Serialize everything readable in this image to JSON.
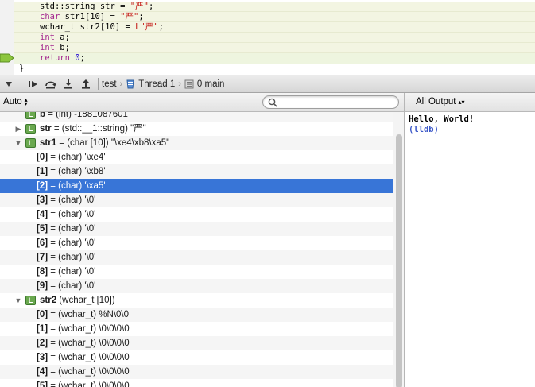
{
  "editor": {
    "lines": [
      {
        "segments": [
          {
            "cls": "plain",
            "text": "std::string str = "
          },
          {
            "cls": "str",
            "text": "\"严\""
          },
          {
            "cls": "plain",
            "text": ";"
          }
        ]
      },
      {
        "segments": [
          {
            "cls": "kw",
            "text": "char"
          },
          {
            "cls": "plain",
            "text": " str1[10] = "
          },
          {
            "cls": "str",
            "text": "\"严\""
          },
          {
            "cls": "plain",
            "text": ";"
          }
        ]
      },
      {
        "segments": [
          {
            "cls": "plain",
            "text": "wchar_t str2[10] = "
          },
          {
            "cls": "str",
            "text": "L\"严\""
          },
          {
            "cls": "plain",
            "text": ";"
          }
        ]
      },
      {
        "segments": [
          {
            "cls": "kw",
            "text": "int"
          },
          {
            "cls": "plain",
            "text": " a;"
          }
        ]
      },
      {
        "segments": [
          {
            "cls": "kw",
            "text": "int"
          },
          {
            "cls": "plain",
            "text": " b;"
          }
        ]
      },
      {
        "segments": [
          {
            "cls": "kw",
            "text": "return"
          },
          {
            "cls": "plain",
            "text": " "
          },
          {
            "cls": "num",
            "text": "0"
          },
          {
            "cls": "plain",
            "text": ";"
          }
        ]
      },
      {
        "segments": [
          {
            "cls": "plain",
            "text": "}"
          }
        ]
      }
    ]
  },
  "debugbar": {
    "breadcrumb": {
      "project": "test",
      "thread": "Thread 1",
      "frame": "0 main"
    }
  },
  "variables": {
    "scope": "Auto",
    "search_placeholder": "",
    "rows": [
      {
        "disc": "none",
        "indent": 0,
        "badge": true,
        "name": "b",
        "value": " = (int) -1881087601",
        "partial": true
      },
      {
        "disc": "right",
        "indent": 0,
        "badge": true,
        "name": "str",
        "value": " = (std::__1::string) \"严\""
      },
      {
        "disc": "down",
        "indent": 0,
        "badge": true,
        "name": "str1",
        "value": " = (char [10]) \"\\xe4\\xb8\\xa5\""
      },
      {
        "disc": "none",
        "indent": 1,
        "badge": false,
        "name": "[0]",
        "value": " = (char) '\\xe4'"
      },
      {
        "disc": "none",
        "indent": 1,
        "badge": false,
        "name": "[1]",
        "value": " = (char) '\\xb8'"
      },
      {
        "disc": "none",
        "indent": 1,
        "badge": false,
        "name": "[2]",
        "value": " = (char) '\\xa5'",
        "selected": true
      },
      {
        "disc": "none",
        "indent": 1,
        "badge": false,
        "name": "[3]",
        "value": " = (char) '\\0'"
      },
      {
        "disc": "none",
        "indent": 1,
        "badge": false,
        "name": "[4]",
        "value": " = (char) '\\0'"
      },
      {
        "disc": "none",
        "indent": 1,
        "badge": false,
        "name": "[5]",
        "value": " = (char) '\\0'"
      },
      {
        "disc": "none",
        "indent": 1,
        "badge": false,
        "name": "[6]",
        "value": " = (char) '\\0'"
      },
      {
        "disc": "none",
        "indent": 1,
        "badge": false,
        "name": "[7]",
        "value": " = (char) '\\0'"
      },
      {
        "disc": "none",
        "indent": 1,
        "badge": false,
        "name": "[8]",
        "value": " = (char) '\\0'"
      },
      {
        "disc": "none",
        "indent": 1,
        "badge": false,
        "name": "[9]",
        "value": " = (char) '\\0'"
      },
      {
        "disc": "down",
        "indent": 0,
        "badge": true,
        "name": "str2",
        "value": " (wchar_t [10])"
      },
      {
        "disc": "none",
        "indent": 1,
        "badge": false,
        "name": "[0]",
        "value": " = (wchar_t) %N\\0\\0"
      },
      {
        "disc": "none",
        "indent": 1,
        "badge": false,
        "name": "[1]",
        "value": " = (wchar_t) \\0\\0\\0\\0"
      },
      {
        "disc": "none",
        "indent": 1,
        "badge": false,
        "name": "[2]",
        "value": " = (wchar_t) \\0\\0\\0\\0"
      },
      {
        "disc": "none",
        "indent": 1,
        "badge": false,
        "name": "[3]",
        "value": " = (wchar_t) \\0\\0\\0\\0"
      },
      {
        "disc": "none",
        "indent": 1,
        "badge": false,
        "name": "[4]",
        "value": " = (wchar_t) \\0\\0\\0\\0"
      },
      {
        "disc": "none",
        "indent": 1,
        "badge": false,
        "name": "[5]",
        "value": " = (wchar_t) \\0\\0\\0\\0"
      }
    ]
  },
  "console": {
    "output_filter": "All Output",
    "lines": [
      {
        "kind": "out",
        "text": "Hello, World!"
      },
      {
        "kind": "prompt",
        "text": "(lldb)"
      }
    ]
  }
}
